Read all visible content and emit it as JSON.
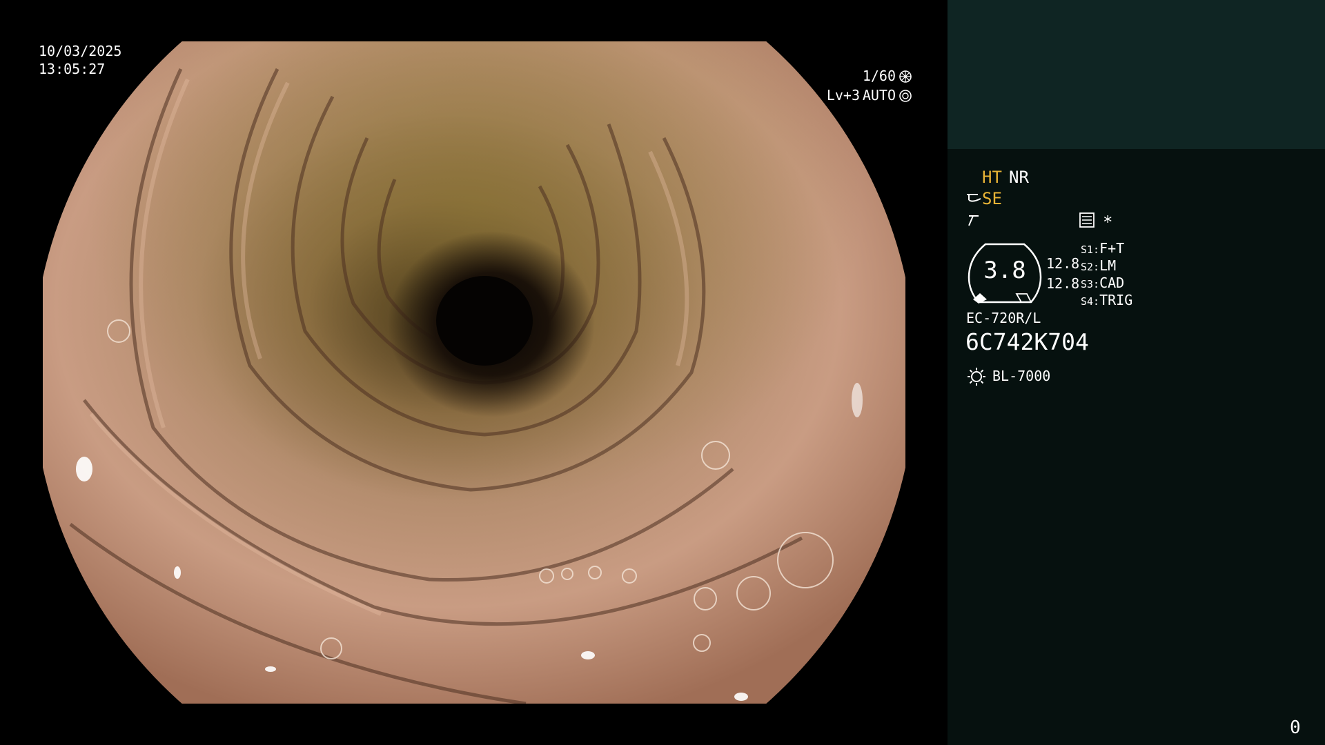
{
  "overlay": {
    "date": "10/03/2025",
    "time": "13:05:27",
    "shutter": "1/60",
    "level_label": "Lv+3",
    "iris_mode": "AUTO",
    "counter": "0"
  },
  "side": {
    "ht": "HT",
    "nr": "NR",
    "se": "SE",
    "gauge_value": "3.8",
    "gauge_side_top": "12.8",
    "gauge_side_bottom": "12.8",
    "switches": [
      {
        "key": "S1:",
        "value": "F+T"
      },
      {
        "key": "S2:",
        "value": "LM"
      },
      {
        "key": "S3:",
        "value": "CAD"
      },
      {
        "key": "S4:",
        "value": "TRIG"
      }
    ],
    "scope_model": "EC-720R/L",
    "scope_serial": "6C742K704",
    "light_source": "BL-7000",
    "asterisk": "*"
  },
  "colors": {
    "accent_yellow": "#e8b436",
    "panel_top": "#0f2523",
    "panel_bg": "#06110f"
  },
  "icons": [
    "shutter-icon",
    "iris-icon",
    "scope-tip-icon",
    "freeze-icon",
    "menu-icon",
    "lamp-icon"
  ]
}
